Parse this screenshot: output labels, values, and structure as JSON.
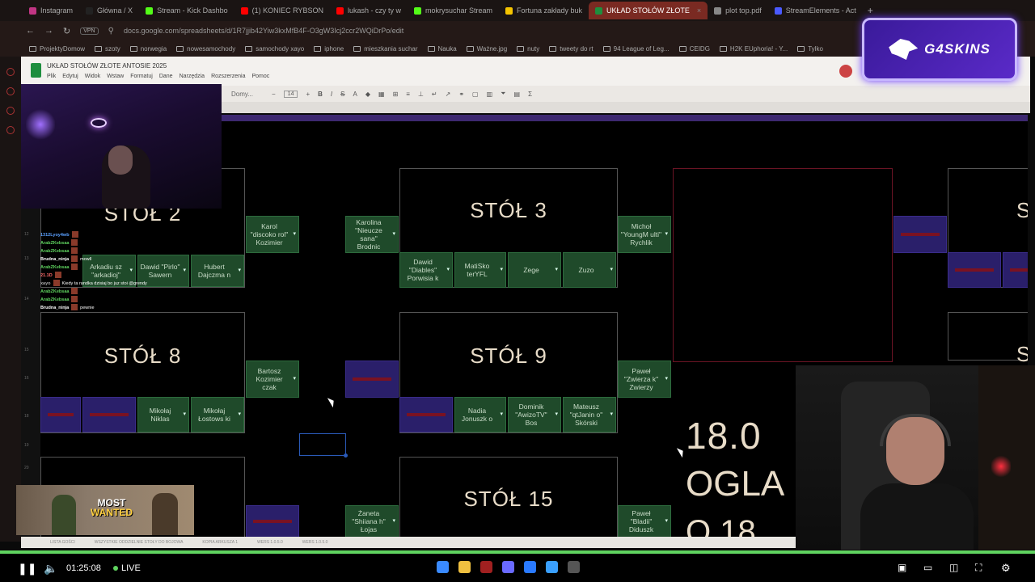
{
  "browser": {
    "tabs": [
      {
        "label": "Instagram",
        "color": "#c13584",
        "active": false
      },
      {
        "label": "Główna / X",
        "color": "#222222",
        "active": false
      },
      {
        "label": "Stream - Kick Dashbo",
        "color": "#53fc18",
        "active": false
      },
      {
        "label": "(1) KONIEC RYBSON",
        "color": "#ff0000",
        "active": false
      },
      {
        "label": "lukash - czy ty w",
        "color": "#ff0000",
        "active": false
      },
      {
        "label": "mokrysuchar Stream",
        "color": "#53fc18",
        "active": false
      },
      {
        "label": "Fortuna zakłady buk",
        "color": "#f5c400",
        "active": false
      },
      {
        "label": "UKŁAD STOŁÓW ZŁOTE",
        "color": "#1e8e3e",
        "active": true
      },
      {
        "label": "plot top.pdf",
        "color": "#888888",
        "active": false
      },
      {
        "label": "StreamElements - Act",
        "color": "#4a5aff",
        "active": false
      }
    ],
    "url": "docs.google.com/spreadsheets/d/1R7jjib42Yiw3kxMfB4F-O3gW3Icj2ccr2WQiDrPo/edit",
    "vpn_label": "VPN",
    "bookmarks": [
      "ProjektyDomow",
      "szoty",
      "norwegia",
      "nowesamochody",
      "samochody xayo",
      "iphone",
      "mieszkania suchar",
      "Nauka",
      "Ważne.jpg",
      "nuty",
      "tweety do rt",
      "94 League of Leg...",
      "CEIDG",
      "H2K EUphoria! - Y...",
      "Tylko"
    ]
  },
  "sheet": {
    "title": "UKŁAD STOŁÓW ZŁOTE ANTOSIE 2025",
    "menu": [
      "Plik",
      "Edytuj",
      "Widok",
      "Wstaw",
      "Formatuj",
      "Dane",
      "Narzędzia",
      "Rozszerzenia",
      "Pomoc"
    ],
    "toolbar": {
      "font": "Domy...",
      "size": "14"
    },
    "tables": [
      {
        "label": "STÓŁ 2"
      },
      {
        "label": "STÓŁ 3"
      },
      {
        "label": "STÓŁ 8"
      },
      {
        "label": "STÓŁ 9"
      },
      {
        "label": "STÓŁ 15"
      },
      {
        "label": "S"
      },
      {
        "label": "S"
      }
    ],
    "players": {
      "karol": "Karol \"discoko rol\" Kozimier",
      "karolina": "Karolina \"Nieucze sana\" Brodnic",
      "michal": "Michoł \"YoungM ulti\" Rychlik",
      "arkadiusz": "Arkadiu sz \"arkadioj\"",
      "dawid_pirlo": "Dawid \"Pirlo\" Sawern",
      "hubert": "Hubert Dajczma n",
      "dawid_diables": "Dawid \"Diables\" Porwisia k",
      "matisko": "MatiSko terYFL",
      "zege": "Zege",
      "zuzo": "Zuzo",
      "bartosz": "Bartosz Kozimier czak",
      "pawel_zwierzak": "Paweł \"Zwierza k\" Zwierzy",
      "mikolaj_niklas": "Mikołaj Niklas",
      "mikolaj_lostows": "Mikołaj Łostows ki",
      "nadia": "Nadia Jonuszk o",
      "dominik": "Dominik \"AwizoTV\" Bos",
      "mateusz": "Mateusz \"qtJanin o\" Skórski",
      "zaneta": "Żaneta \"Shiiana h\" Łojas",
      "pawel_bladii": "Paweł \"Bladii\" Diduszk"
    },
    "big_text": {
      "date": "18.0",
      "ogla": "OGLA",
      "o18": "O 18"
    },
    "sheet_tabs": [
      "LISTA GOŚCI",
      "WSZYSTKIE ODDZIELNIE STOŁY DO BOJOWA",
      "KOPIA ARKUSZA 1",
      "WERS 1.0.5.0",
      "WERS 1.0.5.0"
    ]
  },
  "chat": [
    {
      "user": "1312Lyoy4wb",
      "color": "#5aa0ff",
      "msg": ""
    },
    {
      "user": "ArabZKebsaa",
      "color": "#5fd35f",
      "msg": ""
    },
    {
      "user": "ArabZKebsaa",
      "color": "#5fd35f",
      "msg": ""
    },
    {
      "user": "Brudna_ninja",
      "color": "#ffffff",
      "msg": "mowll"
    },
    {
      "user": "ArabZKebsaa",
      "color": "#5fd35f",
      "msg": ""
    },
    {
      "user": "21.1D",
      "color": "#ff6a6a",
      "msg": ""
    },
    {
      "user": "xayo",
      "color": "#aaaaaa",
      "msg": "Kiedy ta randka dzisiaj bo juz stoi @grendy"
    },
    {
      "user": "ArabZKebsaa",
      "color": "#5fd35f",
      "msg": ""
    },
    {
      "user": "ArabZKebsaa",
      "color": "#5fd35f",
      "msg": ""
    },
    {
      "user": "Brudna_ninja",
      "color": "#ffffff",
      "msg": "pewnie"
    }
  ],
  "overlay": {
    "brand": "G4SKINS",
    "ad_title_line1": "MOST",
    "ad_title_line2": "WANTED"
  },
  "player": {
    "time": "01:25:08",
    "live_label": "LIVE",
    "progress_fraction": 1.0
  }
}
